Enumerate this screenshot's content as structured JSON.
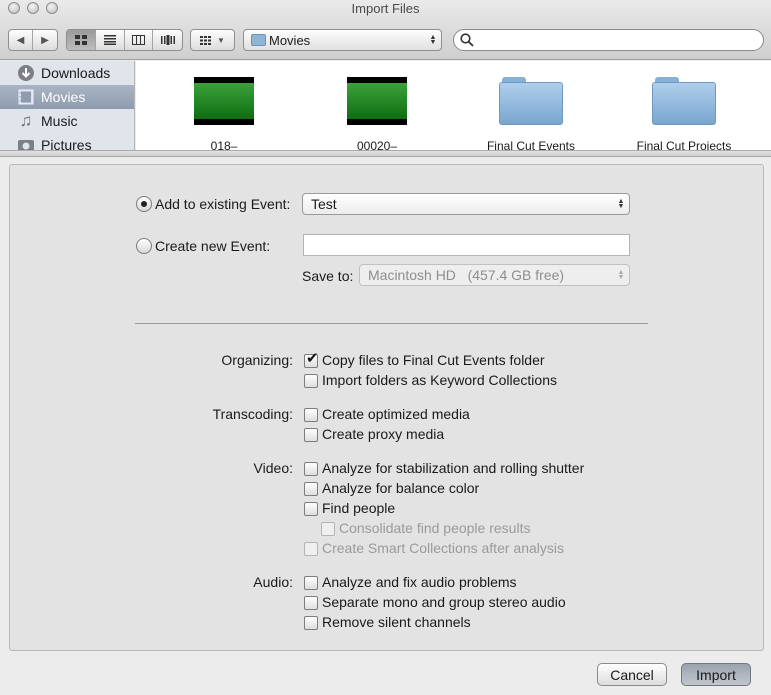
{
  "window": {
    "title": "Import Files"
  },
  "toolbar": {
    "back_icon": "chevron-left-icon",
    "forward_icon": "chevron-right-icon",
    "views": [
      "icon-view",
      "list-view",
      "column-view",
      "coverflow-view"
    ],
    "location": "Movies"
  },
  "sidebar": {
    "items": [
      {
        "label": "Downloads",
        "icon": "downloads-icon",
        "selected": false
      },
      {
        "label": "Movies",
        "icon": "movies-icon",
        "selected": true
      },
      {
        "label": "Music",
        "icon": "music-icon",
        "selected": false
      },
      {
        "label": "Pictures",
        "icon": "pictures-icon",
        "selected": false
      }
    ]
  },
  "files": [
    {
      "name": "018–",
      "kind": "video"
    },
    {
      "name": "00020–",
      "kind": "video"
    },
    {
      "name": "Final Cut Events",
      "kind": "folder"
    },
    {
      "name": "Final Cut Projects",
      "kind": "folder"
    }
  ],
  "event": {
    "add_existing_label": "Add to existing Event:",
    "existing_value": "Test",
    "create_new_label": "Create new Event:",
    "new_value": "",
    "save_to_label": "Save to:",
    "save_to_value": "Macintosh HD   (457.4 GB free)"
  },
  "organizing": {
    "label": "Organizing:",
    "copy_files": "Copy files to Final Cut Events folder",
    "import_folders": "Import folders as Keyword Collections"
  },
  "transcoding": {
    "label": "Transcoding:",
    "optimized": "Create optimized media",
    "proxy": "Create proxy media"
  },
  "video": {
    "label": "Video:",
    "stabilization": "Analyze for stabilization and rolling shutter",
    "balance": "Analyze for balance color",
    "find_people": "Find people",
    "consolidate": "Consolidate find people results",
    "smart_collections": "Create Smart Collections after analysis"
  },
  "audio": {
    "label": "Audio:",
    "fix_problems": "Analyze and fix audio problems",
    "separate_mono": "Separate mono and group stereo audio",
    "remove_silent": "Remove silent channels"
  },
  "buttons": {
    "cancel": "Cancel",
    "import": "Import"
  }
}
